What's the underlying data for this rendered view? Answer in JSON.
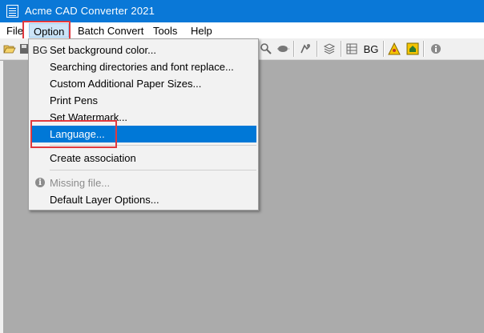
{
  "window": {
    "title": "Acme CAD Converter 2021"
  },
  "menubar": {
    "items": [
      {
        "label": "File"
      },
      {
        "label": "Option"
      },
      {
        "label": "Batch Convert"
      },
      {
        "label": "Tools"
      },
      {
        "label": "Help"
      }
    ],
    "active_index": 1
  },
  "toolbar": {
    "bg_label": "BG",
    "icons": [
      "open-folder-icon",
      "zoom-icon",
      "pan-icon",
      "layer-icon",
      "stack-icon",
      "table-icon",
      "background-icon",
      "alert-icon",
      "home-icon",
      "info-icon"
    ]
  },
  "option_menu": {
    "items": [
      {
        "label": "Set background color...",
        "icon": "background-color-icon",
        "icon_text": "BG"
      },
      {
        "label": "Searching directories and font replace..."
      },
      {
        "label": "Custom Additional Paper Sizes..."
      },
      {
        "label": "Print Pens"
      },
      {
        "label": "Set Watermark..."
      },
      {
        "label": "Language...",
        "highlighted": true
      },
      {
        "label": "Create association"
      },
      {
        "label": "Missing file...",
        "disabled": true,
        "icon": "info-icon",
        "icon_text": "i"
      },
      {
        "label": "Default Layer Options..."
      }
    ]
  },
  "colors": {
    "titlebar": "#0a78d7",
    "highlight": "#0078d7",
    "annotation": "#e0393e",
    "workspace": "#ababab"
  }
}
